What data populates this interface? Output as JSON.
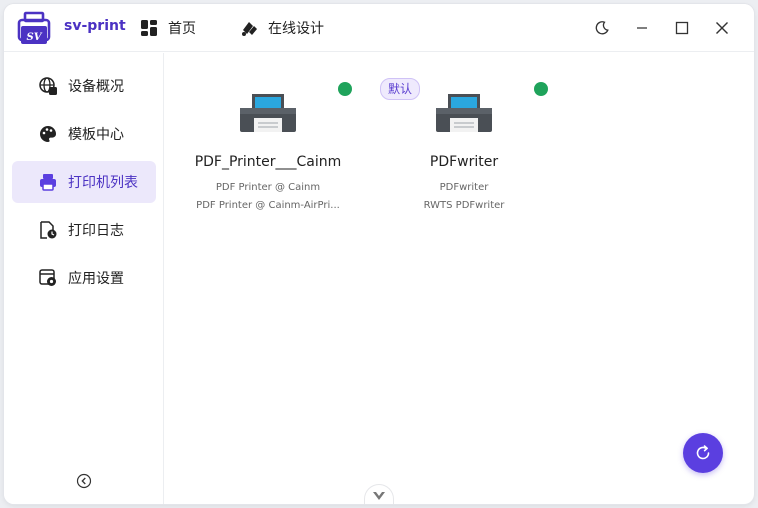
{
  "app": {
    "name": "sv-print"
  },
  "nav": [
    {
      "label": "首页",
      "icon": "dashboard-icon"
    },
    {
      "label": "在线设计",
      "icon": "design-icon"
    }
  ],
  "window_controls": [
    "moon-icon",
    "minimize-icon",
    "maximize-icon",
    "close-icon"
  ],
  "sidebar": {
    "active_index": 2,
    "items": [
      {
        "label": "设备概况",
        "icon": "globe-device-icon"
      },
      {
        "label": "模板中心",
        "icon": "palette-icon"
      },
      {
        "label": "打印机列表",
        "icon": "printer-icon"
      },
      {
        "label": "打印日志",
        "icon": "log-file-icon"
      },
      {
        "label": "应用设置",
        "icon": "settings-window-icon"
      }
    ]
  },
  "printers": [
    {
      "name": "PDF_Printer___Cainm",
      "line1": "PDF Printer @ Cainm",
      "line2": "PDF Printer @ Cainm-AirPri...",
      "status_color": "#1fa35b",
      "is_default": false
    },
    {
      "name": "PDFwriter",
      "line1": "PDFwriter",
      "line2": "RWTS PDFwriter",
      "status_color": "#1fa35b",
      "is_default": true,
      "default_label": "默认"
    }
  ],
  "colors": {
    "accent": "#5b3fe0",
    "active_bg": "#ece8fb",
    "online": "#1fa35b"
  }
}
